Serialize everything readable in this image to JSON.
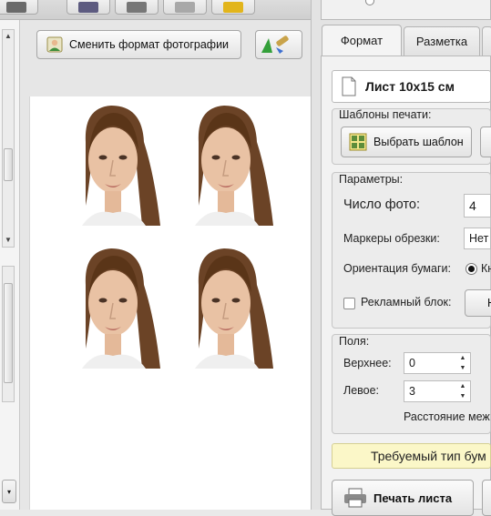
{
  "toolbar": {
    "buttons": [
      {
        "icon": "scanner-icon"
      },
      {
        "icon": "printer-icon"
      },
      {
        "icon": "camera-icon"
      },
      {
        "icon": "tools-icon"
      },
      {
        "icon": "car-icon"
      }
    ]
  },
  "photo_toolbar": {
    "change_format_label": "Сменить формат фотографии"
  },
  "tabs": [
    {
      "label": "Формат",
      "active": true
    },
    {
      "label": "Разметка",
      "active": false
    }
  ],
  "format_panel": {
    "sheet_name": "Лист 10x15 см",
    "templates_title": "Шаблоны печати:",
    "choose_template_label": "Выбрать шаблон",
    "params_title": "Параметры:",
    "photo_count_label": "Число фото:",
    "photo_count_value": "4",
    "crop_markers_label": "Маркеры обрезки:",
    "crop_markers_value": "Нет",
    "orientation_label": "Ориентация бумаги:",
    "orientation_value": "Кн",
    "ad_block_label": "Рекламный блок:",
    "ad_block_button": "Н",
    "margins_title": "Поля:",
    "top_margin_label": "Верхнее:",
    "top_margin_value": "0",
    "left_margin_label": "Левое:",
    "left_margin_value": "3",
    "spacing_label": "Расстояние меж",
    "paper_type_notice": "Требуемый тип бум",
    "print_button": "Печать листа"
  },
  "colors": {
    "notice_bg": "#fbf7c8",
    "hair": "#6b4326",
    "skin": "#e9c2a4"
  }
}
